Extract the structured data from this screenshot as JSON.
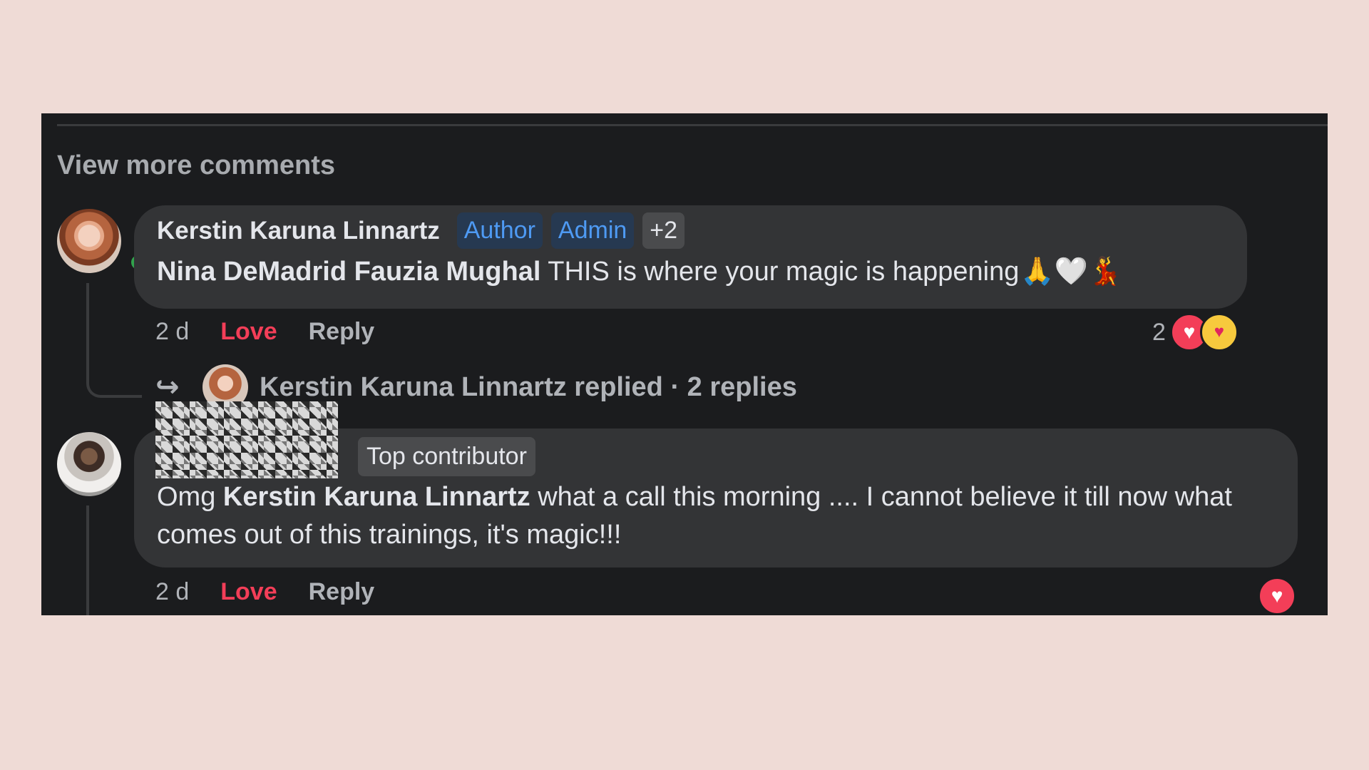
{
  "view_more_label": "View more comments",
  "comments": [
    {
      "author": "Kerstin Karuna Linnartz",
      "badges": [
        "Author",
        "Admin"
      ],
      "extra_badge": "+2",
      "mention": "Nina DeMadrid Fauzia Mughal",
      "text": "THIS is where your magic is happening",
      "emojis": "🙏🤍💃",
      "time": "2 d",
      "love_label": "Love",
      "reply_label": "Reply",
      "reaction_count": "2",
      "reactions": [
        "heart-icon",
        "care-icon"
      ],
      "replies_summary": "Kerstin Karuna Linnartz replied · 2 replies",
      "online": true
    },
    {
      "author_redacted": true,
      "badge": "Top contributor",
      "prefix": "Omg",
      "mention": "Kerstin Karuna Linnartz",
      "text": "what a call this morning .... I cannot believe it till now what comes out of this trainings, it's magic!!!",
      "time": "2 d",
      "love_label": "Love",
      "reply_label": "Reply",
      "reactions": [
        "heart-icon"
      ]
    }
  ],
  "colors": {
    "background": "#efdbd6",
    "panel": "#1b1c1e",
    "bubble": "#333436",
    "love": "#f33e58",
    "badge_blue_text": "#4e9af3"
  }
}
